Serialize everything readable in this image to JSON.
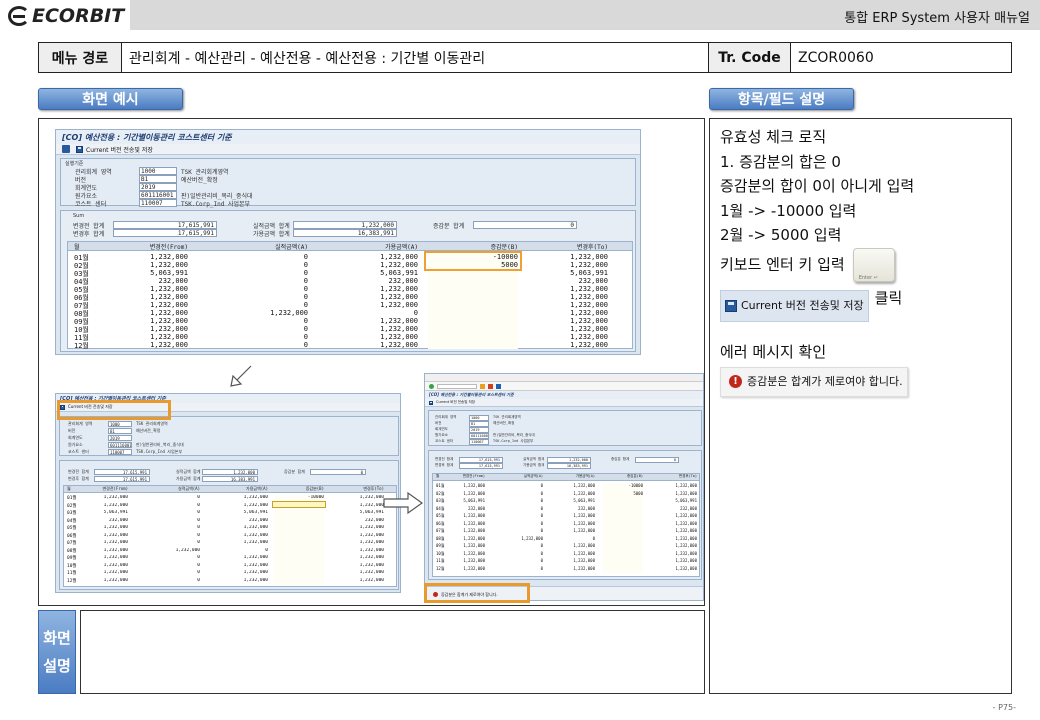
{
  "header": {
    "logo_text": "ECORBIT",
    "doc_title": "통합 ERP System 사용자 매뉴얼"
  },
  "menu": {
    "label": "메뉴 경로",
    "path": "관리회계 - 예산관리 - 예산전용 - 예산전용 : 기간별 이동관리",
    "tr_label": "Tr. Code",
    "tr_code": "ZCOR0060"
  },
  "sections": {
    "screen_example": "화면 예시",
    "field_desc": "항목/필드 설명",
    "screen_desc_1": "화면",
    "screen_desc_2": "설명"
  },
  "description": {
    "lines": [
      "유효성 체크 로직",
      "1.  증감분의 합은 0",
      "증감분의 합이 0이 아니게 입력",
      "1월 -> -10000 입력",
      "2월 -> 5000 입력",
      "키보드 엔터 키 입력"
    ],
    "save_button": "Current 버전 전송및 저장",
    "click_text": "클릭",
    "error_check": "에러 메시지 확인",
    "error_msg": "증감분은 합계가 제로여야 합니다."
  },
  "sap_main": {
    "title": "[CO] 예산전용 : 기간별이동관리 코스트센터 기준",
    "save_label": "Current 버전 전송및 저장",
    "criteria_title": "실행기준",
    "fields": [
      {
        "label": "관리회계 영역",
        "value": "1000",
        "text": "TSK 관리회계영역"
      },
      {
        "label": "버전",
        "value": "B1",
        "text": "예산버전_확정"
      },
      {
        "label": "회계연도",
        "value": "2019",
        "text": ""
      },
      {
        "label": "원가요소",
        "value": "601116001",
        "text": "판)일반관리비_복리_중식대"
      },
      {
        "label": "코스트 센터",
        "value": "110007",
        "text": "TSK.Corp_Ind 사업본부"
      }
    ],
    "sum_title": "Sum",
    "sum_rows": [
      {
        "l1": "변경전 합계",
        "v1": "17,615,991",
        "l2": "실적금액 합계",
        "v2": "1,232,000",
        "l3": "증감분 합계",
        "v3": "0"
      },
      {
        "l1": "변경후 합계",
        "v1": "17,615,991",
        "l2": "가용금액 합계",
        "v2": "16,383,991",
        "l3": "",
        "v3": ""
      }
    ],
    "columns": [
      "월",
      "변경전(From)",
      "실적금액(A)",
      "가용금액(A)",
      "증감분(B)",
      "변경후(To)"
    ],
    "rows": [
      [
        "01월",
        "1,232,000",
        "0",
        "1,232,000",
        "-10000",
        "1,232,000"
      ],
      [
        "02월",
        "1,232,000",
        "0",
        "1,232,000",
        "5000",
        "1,232,000"
      ],
      [
        "03월",
        "5,063,991",
        "0",
        "5,063,991",
        "",
        "5,063,991"
      ],
      [
        "04월",
        "232,000",
        "0",
        "232,000",
        "",
        "232,000"
      ],
      [
        "05월",
        "1,232,000",
        "0",
        "1,232,000",
        "",
        "1,232,000"
      ],
      [
        "06월",
        "1,232,000",
        "0",
        "1,232,000",
        "",
        "1,232,000"
      ],
      [
        "07월",
        "1,232,000",
        "0",
        "1,232,000",
        "",
        "1,232,000"
      ],
      [
        "08월",
        "1,232,000",
        "1,232,000",
        "0",
        "",
        "1,232,000"
      ],
      [
        "09월",
        "1,232,000",
        "0",
        "1,232,000",
        "",
        "1,232,000"
      ],
      [
        "10월",
        "1,232,000",
        "0",
        "1,232,000",
        "",
        "1,232,000"
      ],
      [
        "11월",
        "1,232,000",
        "0",
        "1,232,000",
        "",
        "1,232,000"
      ],
      [
        "12월",
        "1,232,000",
        "0",
        "1,232,000",
        "",
        "1,232,000"
      ]
    ]
  },
  "page": "- P75-"
}
